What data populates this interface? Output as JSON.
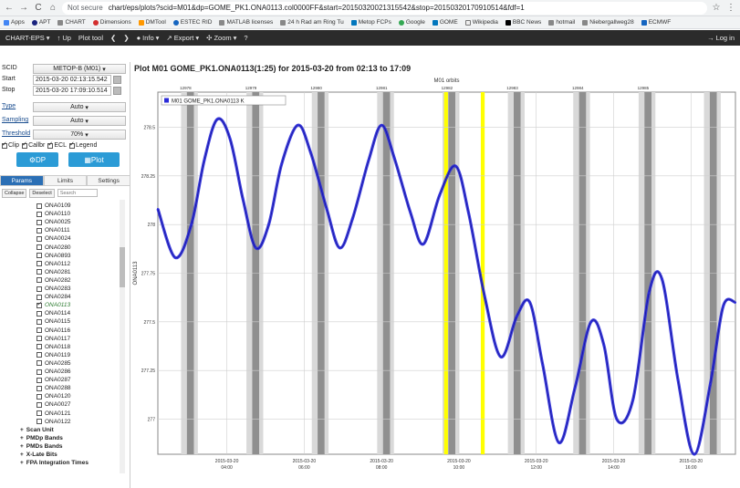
{
  "browser": {
    "security": "Not secure",
    "url": "chart/eps/plots?scid=M01&dp=GOME_PK1.ONA0113.col0000FF&start=20150320021315542&stop=20150320170910514&fdf=1",
    "bookmarks": [
      "Apps",
      "APT",
      "CHART",
      "Dimensions",
      "DMTool",
      "ESTEC RID",
      "MATLAB licenses",
      "24 h Rad am Ring Tu",
      "Metop FCPs",
      "Google",
      "GOME",
      "Wikipedia",
      "BBC News",
      "hotmail",
      "Niebergallweg28",
      "ECMWF"
    ]
  },
  "toolbar": {
    "app_name": "CHART-EPS",
    "up_label": "Up",
    "plot_tool_label": "Plot tool",
    "info_label": "Info",
    "export_label": "Export",
    "zoom_label": "Zoom",
    "login_label": "Log in"
  },
  "sidebar": {
    "scid_label": "SCID",
    "scid_value": "METOP-B (M01)",
    "start_label": "Start",
    "start_value": "2015-03-20 02:13:15.542",
    "stop_label": "Stop",
    "stop_value": "2015-03-20 17:09:10.514",
    "type_label": "Type",
    "type_value": "Auto",
    "sampling_label": "Sampling",
    "sampling_value": "Auto",
    "threshold_label": "Threshold",
    "threshold_value": "70%",
    "checks": [
      {
        "label": "Clip",
        "checked": true
      },
      {
        "label": "Callbr",
        "checked": true
      },
      {
        "label": "ECL",
        "checked": true
      },
      {
        "label": "Legend",
        "checked": true
      }
    ],
    "dp_button": "DP",
    "plot_button": "Plot",
    "tabs": [
      "Params",
      "Limits",
      "Settings"
    ],
    "collapse_label": "Collapse",
    "deselect_label": "Deselect",
    "search_placeholder": "Search",
    "params": [
      "ONA0109",
      "ONA0110",
      "ONA0025",
      "ONA0111",
      "ONA0024",
      "ONA0280",
      "ONA0893",
      "ONA0112",
      "ONA0281",
      "ONA0282",
      "ONA0283",
      "ONA0284",
      "ONA0113",
      "ONA0114",
      "ONA0115",
      "ONA0116",
      "ONA0117",
      "ONA0118",
      "ONA0119",
      "ONA0285",
      "ONA0286",
      "ONA0287",
      "ONA0288",
      "ONA0120",
      "ONA0027",
      "ONA0121",
      "ONA0122"
    ],
    "selected_param": "ONA0113",
    "groups": [
      "Scan Unit",
      "PMDp Bands",
      "PMDs Bands",
      "X-Late Bits",
      "FPA Integration Times"
    ]
  },
  "chart": {
    "title": "Plot M01 GOME_PK1.ONA0113(1:25) for 2015-03-20 from 02:13 to 17:09",
    "top_axis_label": "M01 orbits",
    "ylabel": "ONA0113",
    "legend_label": "M01 GOME_PK1.ONA0113 K",
    "series_color": "#2a2ad8",
    "highlight_color": "#ffff00"
  },
  "chart_data": {
    "type": "line",
    "title": "Plot M01 GOME_PK1.ONA0113(1:25) for 2015-03-20 from 02:13 to 17:09",
    "xlabel": "",
    "ylabel": "ONA0113",
    "xlim": [
      "2015-03-20 02:13",
      "2015-03-20 17:09"
    ],
    "ylim": [
      276.82,
      278.68
    ],
    "yticks": [
      277,
      277.25,
      277.5,
      277.75,
      278,
      278.25,
      278.5
    ],
    "xticks": [
      "2015-03-20 04:00",
      "2015-03-20 06:00",
      "2015-03-20 08:00",
      "2015-03-20 10:00",
      "2015-03-20 12:00",
      "2015-03-20 14:00",
      "2015-03-20 16:00"
    ],
    "orbit_ticks": [
      "12978",
      "12979",
      "12980",
      "12981",
      "12982",
      "12983",
      "12984",
      "12985"
    ],
    "series": [
      {
        "name": "M01 GOME_PK1.ONA0113 K",
        "color": "#2a2ad8",
        "x": [
          "02:13",
          "02:40",
          "03:05",
          "03:25",
          "03:45",
          "04:05",
          "04:25",
          "04:45",
          "05:05",
          "05:25",
          "05:50",
          "06:10",
          "06:35",
          "06:55",
          "07:15",
          "07:40",
          "08:00",
          "08:20",
          "08:45",
          "09:05",
          "09:30",
          "09:55",
          "10:15",
          "10:40",
          "11:05",
          "11:30",
          "11:50",
          "12:10",
          "12:35",
          "13:00",
          "13:25",
          "13:45",
          "14:05",
          "14:30",
          "14:55",
          "15:15",
          "15:40",
          "16:05",
          "16:30",
          "16:50",
          "17:09"
        ],
        "y": [
          278.08,
          277.83,
          278.0,
          278.33,
          278.54,
          278.44,
          278.13,
          277.88,
          278.0,
          278.31,
          278.51,
          278.37,
          278.08,
          277.88,
          278.03,
          278.33,
          278.51,
          278.34,
          278.06,
          277.9,
          278.15,
          278.3,
          278.06,
          277.63,
          277.32,
          277.53,
          277.6,
          277.28,
          276.88,
          277.16,
          277.5,
          277.38,
          277.0,
          277.1,
          277.65,
          277.72,
          277.2,
          276.82,
          277.18,
          277.58,
          277.6
        ]
      }
    ],
    "eclipse_bands": "alternating light and dark grey",
    "highlight_bands": "yellow",
    "grid": true,
    "legend": "top-left"
  }
}
